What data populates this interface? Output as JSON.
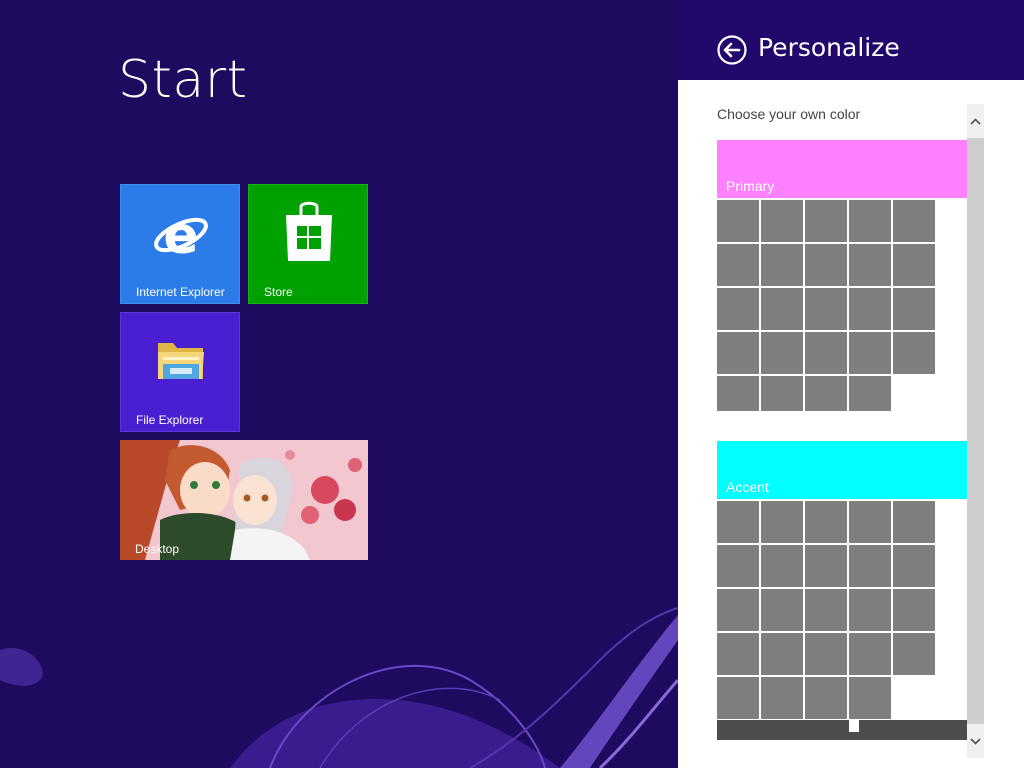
{
  "start": {
    "title": "Start",
    "tiles": [
      {
        "label": "Internet Explorer",
        "icon": "internet-explorer-icon",
        "color": "#2b7be8"
      },
      {
        "label": "Store",
        "icon": "store-bag-icon",
        "color": "#00a100"
      },
      {
        "label": "File Explorer",
        "icon": "folder-icon",
        "color": "#4a1fd1"
      },
      {
        "label": "Desktop",
        "icon": "desktop-wallpaper",
        "color": "#f3cbd3"
      }
    ],
    "background_color": "#1e0a5e"
  },
  "pane": {
    "title": "Personalize",
    "back_icon": "back-arrow-icon",
    "section_label": "Choose your own color",
    "primary": {
      "label": "Primary",
      "color": "#ff80ff"
    },
    "accent": {
      "label": "Accent",
      "color": "#00ffff"
    },
    "swatch_color": "#7f7f7f",
    "slider_value_fraction": 0.55,
    "header_color": "#22086a"
  }
}
